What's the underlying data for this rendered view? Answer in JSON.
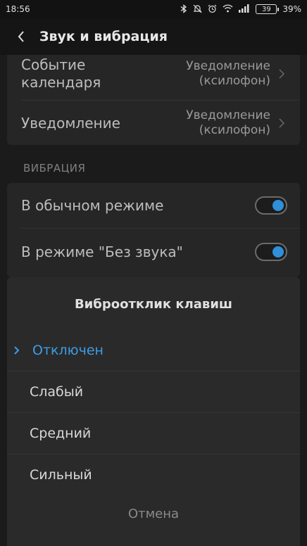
{
  "status_bar": {
    "time": "18:56",
    "battery_level": "39",
    "battery_percent": "39%",
    "icons": [
      "bluetooth-icon",
      "mute-icon",
      "alarm-icon",
      "wifi-icon",
      "signal-icon",
      "battery-icon"
    ]
  },
  "app_bar": {
    "title": "Звук и вибрация"
  },
  "ringtones": [
    {
      "label_line1": "Событие",
      "label_line2": "календаря",
      "value_line1": "Уведомление",
      "value_line2": "(ксилофон)"
    },
    {
      "label_line1": "Уведомление",
      "label_line2": "",
      "value_line1": "Уведомление",
      "value_line2": "(ксилофон)"
    }
  ],
  "vibration_section": {
    "header": "ВИБРАЦИЯ",
    "items": [
      {
        "label": "В обычном режиме",
        "enabled": true
      },
      {
        "label": "В режиме \"Без звука\"",
        "enabled": true
      }
    ]
  },
  "dialog": {
    "title": "Виброотклик клавиш",
    "options": [
      "Отключен",
      "Слабый",
      "Средний",
      "Сильный"
    ],
    "selected": "Отключен",
    "cancel": "Отмена"
  },
  "colors": {
    "accent": "#3d9de6",
    "background": "#1b1b1b",
    "card": "#262626",
    "sheet": "#2a2a2a"
  }
}
